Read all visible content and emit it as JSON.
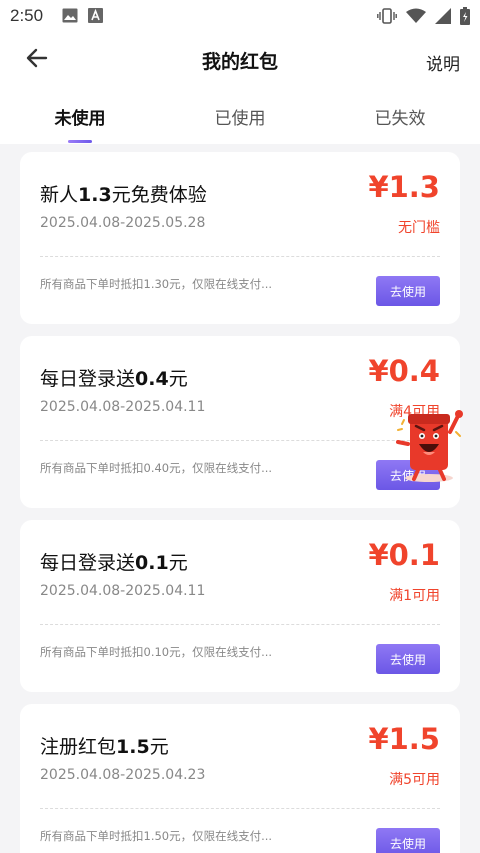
{
  "status_bar": {
    "time": "2:50"
  },
  "header": {
    "title": "我的红包",
    "help_label": "说明"
  },
  "tabs": [
    {
      "label": "未使用"
    },
    {
      "label": "已使用"
    },
    {
      "label": "已失效"
    }
  ],
  "coupons": [
    {
      "name_pre": "新人",
      "name_bold": "1.3",
      "name_post": "元免费体验",
      "date": "2025.04.08-2025.05.28",
      "amount": "¥1.3",
      "condition": "无门槛",
      "desc": "所有商品下单时抵扣1.30元，仅限在线支付...",
      "button": "去使用"
    },
    {
      "name_pre": "每日登录送",
      "name_bold": "0.4",
      "name_post": "元",
      "date": "2025.04.08-2025.04.11",
      "amount": "¥0.4",
      "condition": "满4可用",
      "desc": "所有商品下单时抵扣0.40元，仅限在线支付...",
      "button": "去使用"
    },
    {
      "name_pre": "每日登录送",
      "name_bold": "0.1",
      "name_post": "元",
      "date": "2025.04.08-2025.04.11",
      "amount": "¥0.1",
      "condition": "满1可用",
      "desc": "所有商品下单时抵扣0.10元，仅限在线支付...",
      "button": "去使用"
    },
    {
      "name_pre": "注册红包",
      "name_bold": "1.5",
      "name_post": "元",
      "date": "2025.04.08-2025.04.23",
      "amount": "¥1.5",
      "condition": "满5可用",
      "desc": "所有商品下单时抵扣1.50元，仅限在线支付...",
      "button": "去使用"
    }
  ],
  "colors": {
    "accent": "#6d59ea",
    "price": "#f0442c"
  }
}
